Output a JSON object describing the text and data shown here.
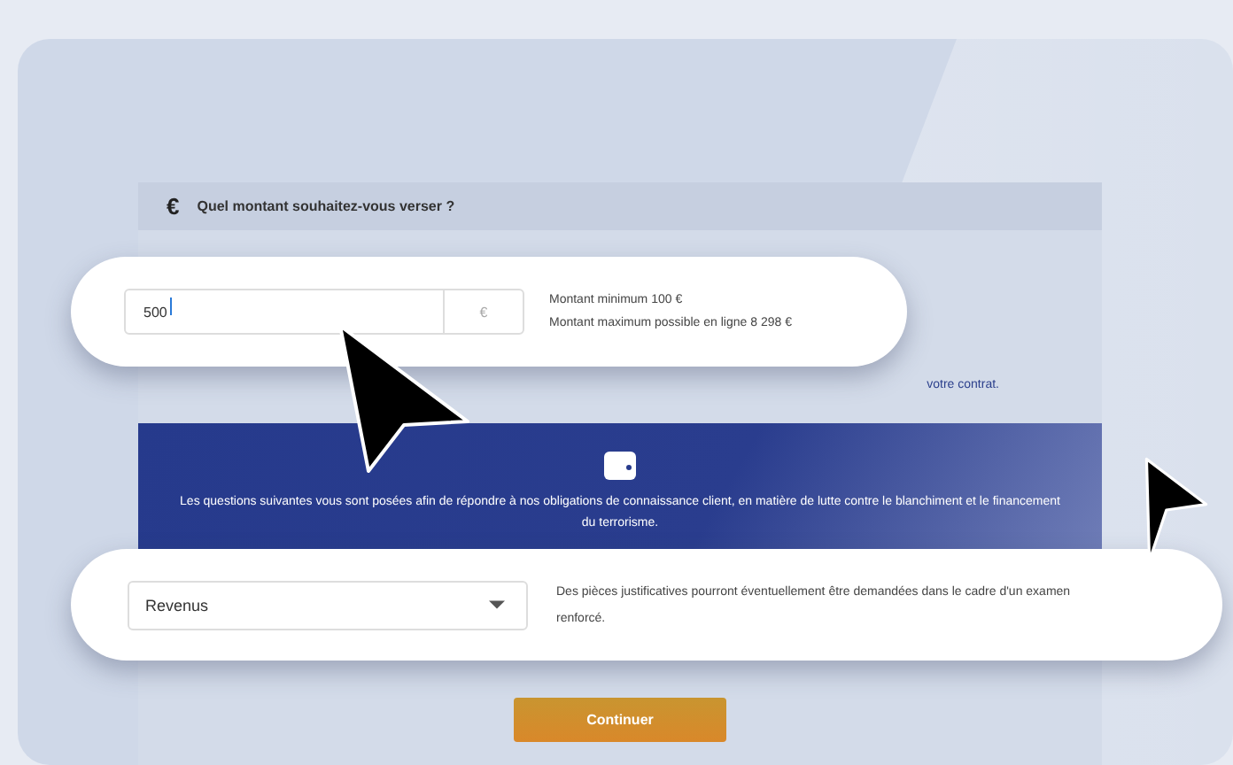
{
  "section": {
    "title": "Quel montant souhaitez-vous verser ?",
    "behind_text": "votre contrat."
  },
  "amount": {
    "value": "500",
    "currency": "€",
    "hints": [
      "Montant minimum 100 €",
      "Montant maximum possible en ligne 8 298 €"
    ]
  },
  "banner": {
    "text": "Les questions suivantes vous sont posées afin de répondre à nos obligations de connaissance client, en matière de lutte contre le blanchiment et le financement du terrorisme."
  },
  "origin": {
    "value": "Revenus",
    "note": "Des pièces justificatives pourront éventuellement être demandées dans le cadre d'un examen renforcé."
  },
  "buttons": [
    {
      "label": "Continuer"
    }
  ]
}
